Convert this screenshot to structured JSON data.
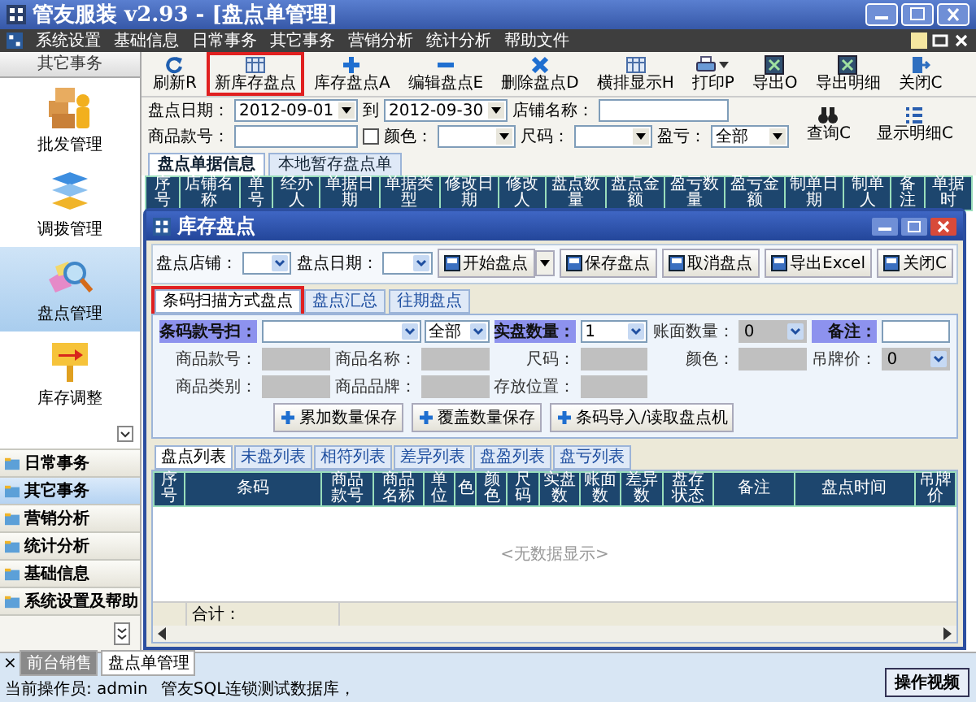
{
  "window": {
    "title": "管友服装 v2.93 - [盘点单管理]"
  },
  "menu": [
    "系统设置",
    "基础信息",
    "日常事务",
    "其它事务",
    "营销分析",
    "统计分析",
    "帮助文件"
  ],
  "sidebar": {
    "header": "其它事务",
    "modules": [
      {
        "label": "批发管理",
        "selected": false
      },
      {
        "label": "调拨管理",
        "selected": false
      },
      {
        "label": "盘点管理",
        "selected": true
      },
      {
        "label": "库存调整",
        "selected": false
      }
    ],
    "groups": [
      {
        "label": "日常事务",
        "selected": false
      },
      {
        "label": "其它事务",
        "selected": true
      },
      {
        "label": "营销分析",
        "selected": false
      },
      {
        "label": "统计分析",
        "selected": false
      },
      {
        "label": "基础信息",
        "selected": false
      },
      {
        "label": "系统设置及帮助",
        "selected": false
      }
    ]
  },
  "toolbar": [
    {
      "label": "刷新R",
      "highlighted": false,
      "dropdown": false
    },
    {
      "label": "新库存盘点",
      "highlighted": true,
      "dropdown": false
    },
    {
      "label": "库存盘点A",
      "highlighted": false,
      "dropdown": false
    },
    {
      "label": "编辑盘点E",
      "highlighted": false,
      "dropdown": false
    },
    {
      "label": "删除盘点D",
      "highlighted": false,
      "dropdown": false
    },
    {
      "label": "横排显示H",
      "highlighted": false,
      "dropdown": false
    },
    {
      "label": "打印P",
      "highlighted": false,
      "dropdown": true
    },
    {
      "label": "导出O",
      "highlighted": false,
      "dropdown": false
    },
    {
      "label": "导出明细",
      "highlighted": false,
      "dropdown": false
    },
    {
      "label": "关闭C",
      "highlighted": false,
      "dropdown": false
    }
  ],
  "filters": {
    "date_label": "盘点日期：",
    "date_from": "2012-09-01",
    "to_label": "到",
    "date_to": "2012-09-30",
    "store_label": "店铺名称：",
    "style_label": "商品款号：",
    "style_checked": false,
    "color_label": "颜色：",
    "size_label": "尺码：",
    "profit_label": "盈亏：",
    "profit_value": "全部",
    "query_button": "查询C",
    "detail_button": "显示明细C"
  },
  "tabs": [
    {
      "label": "盘点单据信息",
      "selected": true
    },
    {
      "label": "本地暂存盘点单",
      "selected": false
    }
  ],
  "table": {
    "columns": [
      "序号",
      "店铺名称",
      "单号",
      "经办人",
      "单据日期",
      "单据类型",
      "修改日期",
      "修改人",
      "盘点数量",
      "盘点金额",
      "盈亏数量",
      "盈亏金额",
      "制单日期",
      "制单人",
      "备注",
      "单据时"
    ]
  },
  "dialog": {
    "title": "库存盘点",
    "store_label": "盘点店铺：",
    "date_label": "盘点日期：",
    "buttons": [
      {
        "label": "开始盘点",
        "dropdown": true
      },
      {
        "label": "保存盘点",
        "dropdown": false
      },
      {
        "label": "取消盘点",
        "dropdown": false
      },
      {
        "label": "导出Excel",
        "dropdown": false
      },
      {
        "label": "关闭C",
        "dropdown": false
      }
    ],
    "tabs": [
      {
        "label": "条码扫描方式盘点",
        "selected": true,
        "highlighted": true
      },
      {
        "label": "盘点汇总",
        "selected": false,
        "highlighted": false
      },
      {
        "label": "往期盘点",
        "selected": false,
        "highlighted": false
      }
    ],
    "fields": [
      {
        "label": "条码款号扫：",
        "kind": "scan",
        "option": "全部",
        "disabled": false,
        "emphasized": true
      },
      {
        "label": "实盘数量：",
        "kind": "select",
        "value": "1",
        "disabled": false,
        "emphasized": true
      },
      {
        "label": "账面数量：",
        "kind": "select",
        "value": "0",
        "disabled": true,
        "emphasized": false
      },
      {
        "label": "备注：",
        "kind": "text",
        "disabled": false,
        "emphasized": true
      },
      {
        "label": "商品款号：",
        "kind": "text",
        "disabled": true,
        "emphasized": false
      },
      {
        "label": "商品名称：",
        "kind": "text",
        "disabled": true,
        "emphasized": false
      },
      {
        "label": "尺码：",
        "kind": "text",
        "disabled": true,
        "emphasized": false
      },
      {
        "label": "颜色：",
        "kind": "text",
        "disabled": true,
        "emphasized": false
      },
      {
        "label": "吊牌价：",
        "kind": "select",
        "value": "0",
        "disabled": true,
        "emphasized": false
      },
      {
        "label": "商品类别：",
        "kind": "text",
        "disabled": true,
        "emphasized": false
      },
      {
        "label": "商品品牌：",
        "kind": "text",
        "disabled": true,
        "emphasized": false
      },
      {
        "label": "存放位置：",
        "kind": "text",
        "disabled": true,
        "emphasized": false
      }
    ],
    "actions": [
      "累加数量保存",
      "覆盖数量保存",
      "条码导入/读取盘点机"
    ],
    "list_tabs": [
      {
        "label": "盘点列表",
        "selected": true
      },
      {
        "label": "未盘列表",
        "selected": false
      },
      {
        "label": "相符列表",
        "selected": false
      },
      {
        "label": "差异列表",
        "selected": false
      },
      {
        "label": "盘盈列表",
        "selected": false
      },
      {
        "label": "盘亏列表",
        "selected": false
      }
    ],
    "columns": [
      "序号",
      "条码",
      "商品款号",
      "商品名称",
      "单位",
      "色",
      "颜色",
      "尺码",
      "实盘数",
      "账面数",
      "差异数",
      "盘存状态",
      "备注",
      "盘点时间",
      "吊牌价"
    ],
    "empty_text": "<无数据显示>",
    "total_label": "合计："
  },
  "bottom_tabs": {
    "close": "×",
    "tabs": [
      {
        "label": "前台销售",
        "selected": false
      },
      {
        "label": "盘点单管理",
        "selected": true
      }
    ]
  },
  "status": [
    "当前操作员: admin",
    "管友SQL连锁测试数据库，"
  ],
  "video_button": "操作视频"
}
